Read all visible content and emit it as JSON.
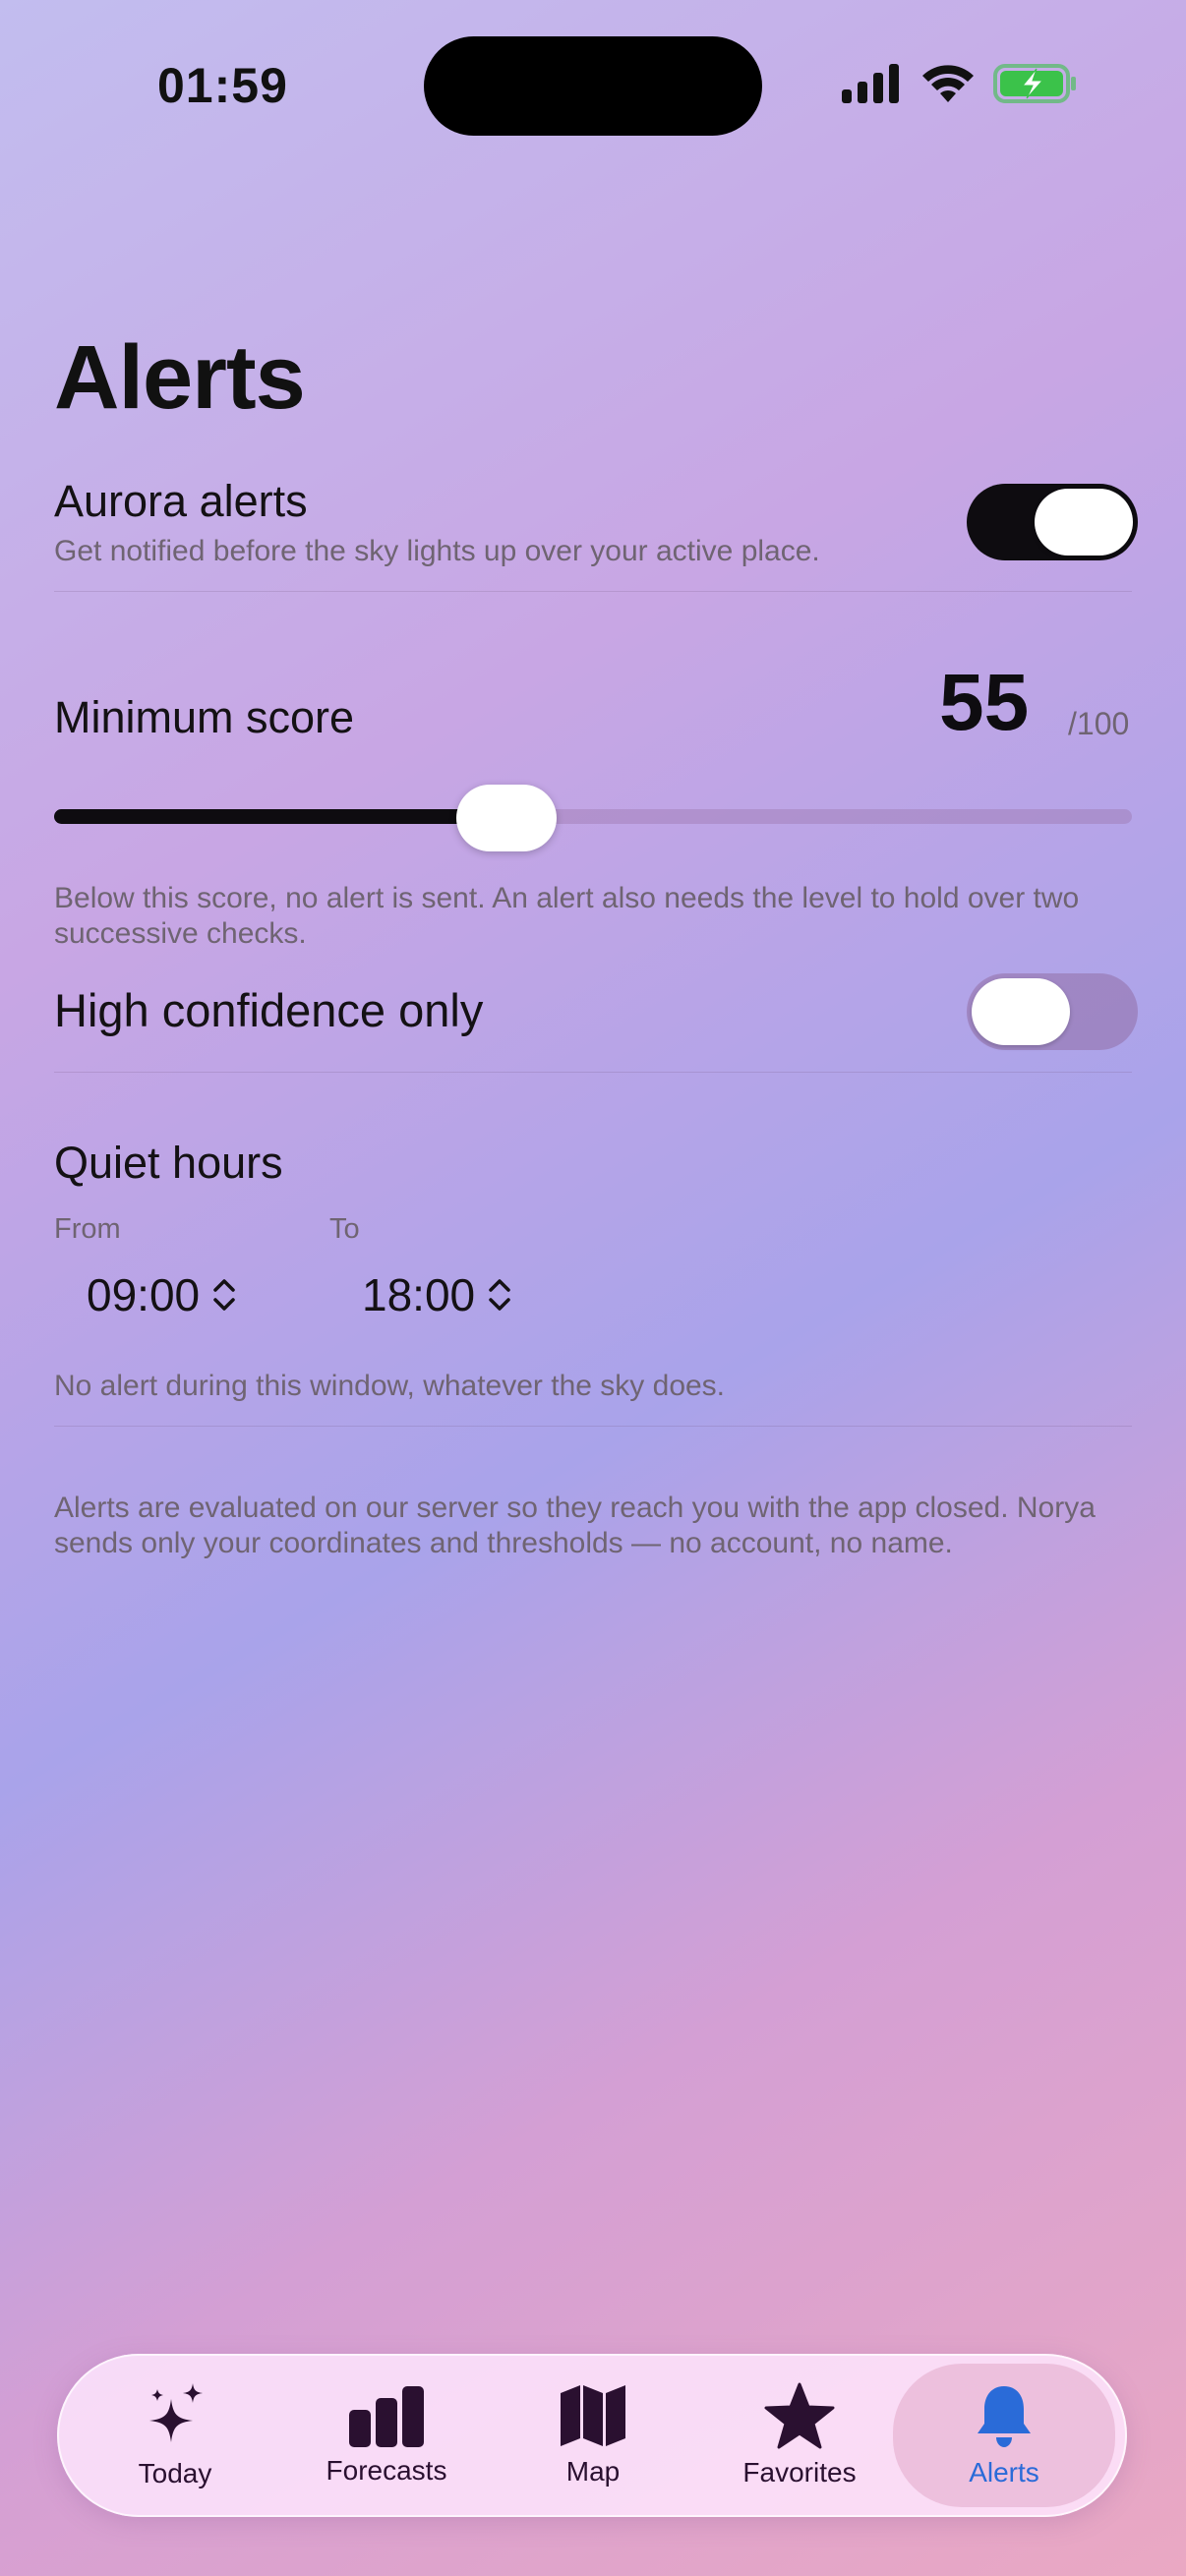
{
  "status_bar": {
    "time": "01:59"
  },
  "title": "Alerts",
  "aurora_alerts": {
    "label": "Aurora alerts",
    "description": "Get notified before the sky lights up over your active place.",
    "enabled": true
  },
  "minimum_score": {
    "label": "Minimum score",
    "value": "55",
    "max": "/100",
    "fraction": 0.42,
    "description": "Below this score, no alert is sent. An alert also needs the level to hold over two successive checks."
  },
  "high_confidence": {
    "label": "High confidence only",
    "enabled": false
  },
  "quiet_hours": {
    "label": "Quiet hours",
    "from_label": "From",
    "from_value": "09:00",
    "to_label": "To",
    "to_value": "18:00",
    "description": "No alert during this window, whatever the sky does."
  },
  "footer_note": "Alerts are evaluated on our server so they reach you with the app closed. Norya sends only your coordinates and thresholds — no account, no name.",
  "tabs": [
    {
      "label": "Today",
      "icon": "sparkles-icon"
    },
    {
      "label": "Forecasts",
      "icon": "bar-chart-icon"
    },
    {
      "label": "Map",
      "icon": "map-icon"
    },
    {
      "label": "Favorites",
      "icon": "star-icon"
    },
    {
      "label": "Alerts",
      "icon": "bell-icon",
      "active": true
    }
  ],
  "colors": {
    "accent": "#2a6bd8",
    "battery": "#3bc24a",
    "toggle_on": "#0e0c10"
  }
}
